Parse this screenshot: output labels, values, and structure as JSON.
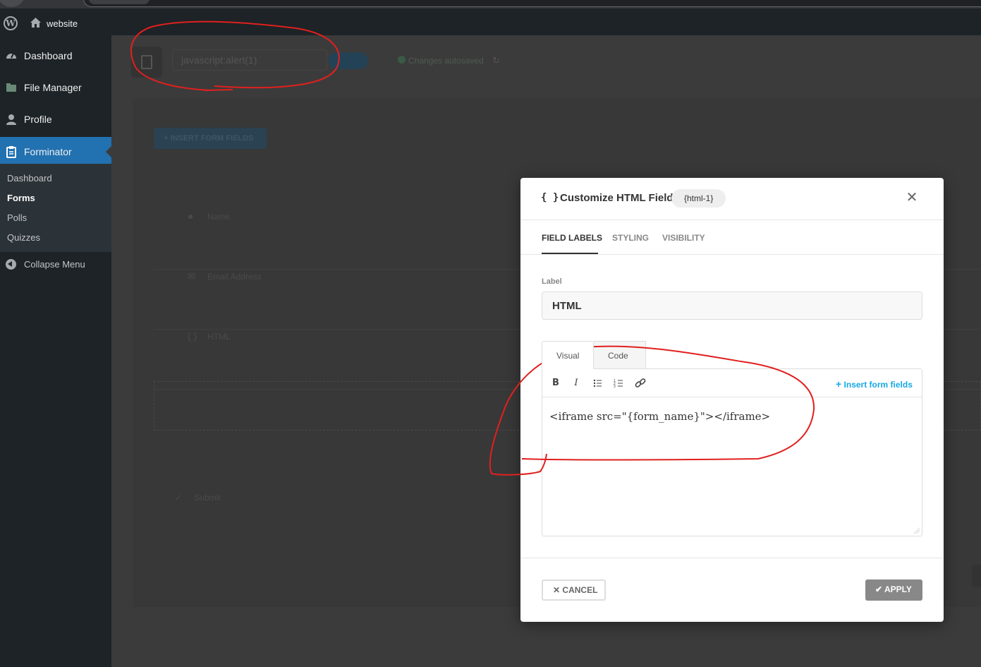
{
  "admin_bar": {
    "site_name": "website"
  },
  "sidebar": {
    "items": [
      {
        "label": "Dashboard",
        "icon": "dashboard-icon"
      },
      {
        "label": "File Manager",
        "icon": "folder-icon"
      },
      {
        "label": "Profile",
        "icon": "user-icon"
      },
      {
        "label": "Forminator",
        "icon": "clipboard-icon",
        "active": true
      }
    ],
    "submenu": [
      "Dashboard",
      "Forms",
      "Polls",
      "Quizzes"
    ],
    "submenu_current": "Forms",
    "collapse_label": "Collapse Menu"
  },
  "builder": {
    "form_title": "javascript:alert(1)",
    "autosave": "Changes autosaved",
    "insert_button": "+ INSERT FORM FIELDS",
    "fields": [
      {
        "label": "Name",
        "icon": "user-icon"
      },
      {
        "label": "Email Address",
        "icon": "mail-icon"
      },
      {
        "label": "HTML",
        "icon": "braces-icon"
      }
    ],
    "submit_label": "Submit"
  },
  "modal": {
    "title": "Customize HTML Field",
    "tag": "{html-1}",
    "tabs": [
      "FIELD LABELS",
      "STYLING",
      "VISIBILITY"
    ],
    "active_tab": "FIELD LABELS",
    "label_caption": "Label",
    "label_value": "HTML",
    "editor_tabs": {
      "visual": "Visual",
      "code": "Code"
    },
    "insert_fields_label": "Insert form fields",
    "editor_content": "<iframe src=\"{form_name}\"></iframe>",
    "cancel_label": "CANCEL",
    "apply_label": "APPLY"
  },
  "colors": {
    "admin_bg": "#1d2327",
    "active_menu": "#2271b1",
    "link_blue": "#17a8e3",
    "annotation_red": "#e0201e"
  }
}
